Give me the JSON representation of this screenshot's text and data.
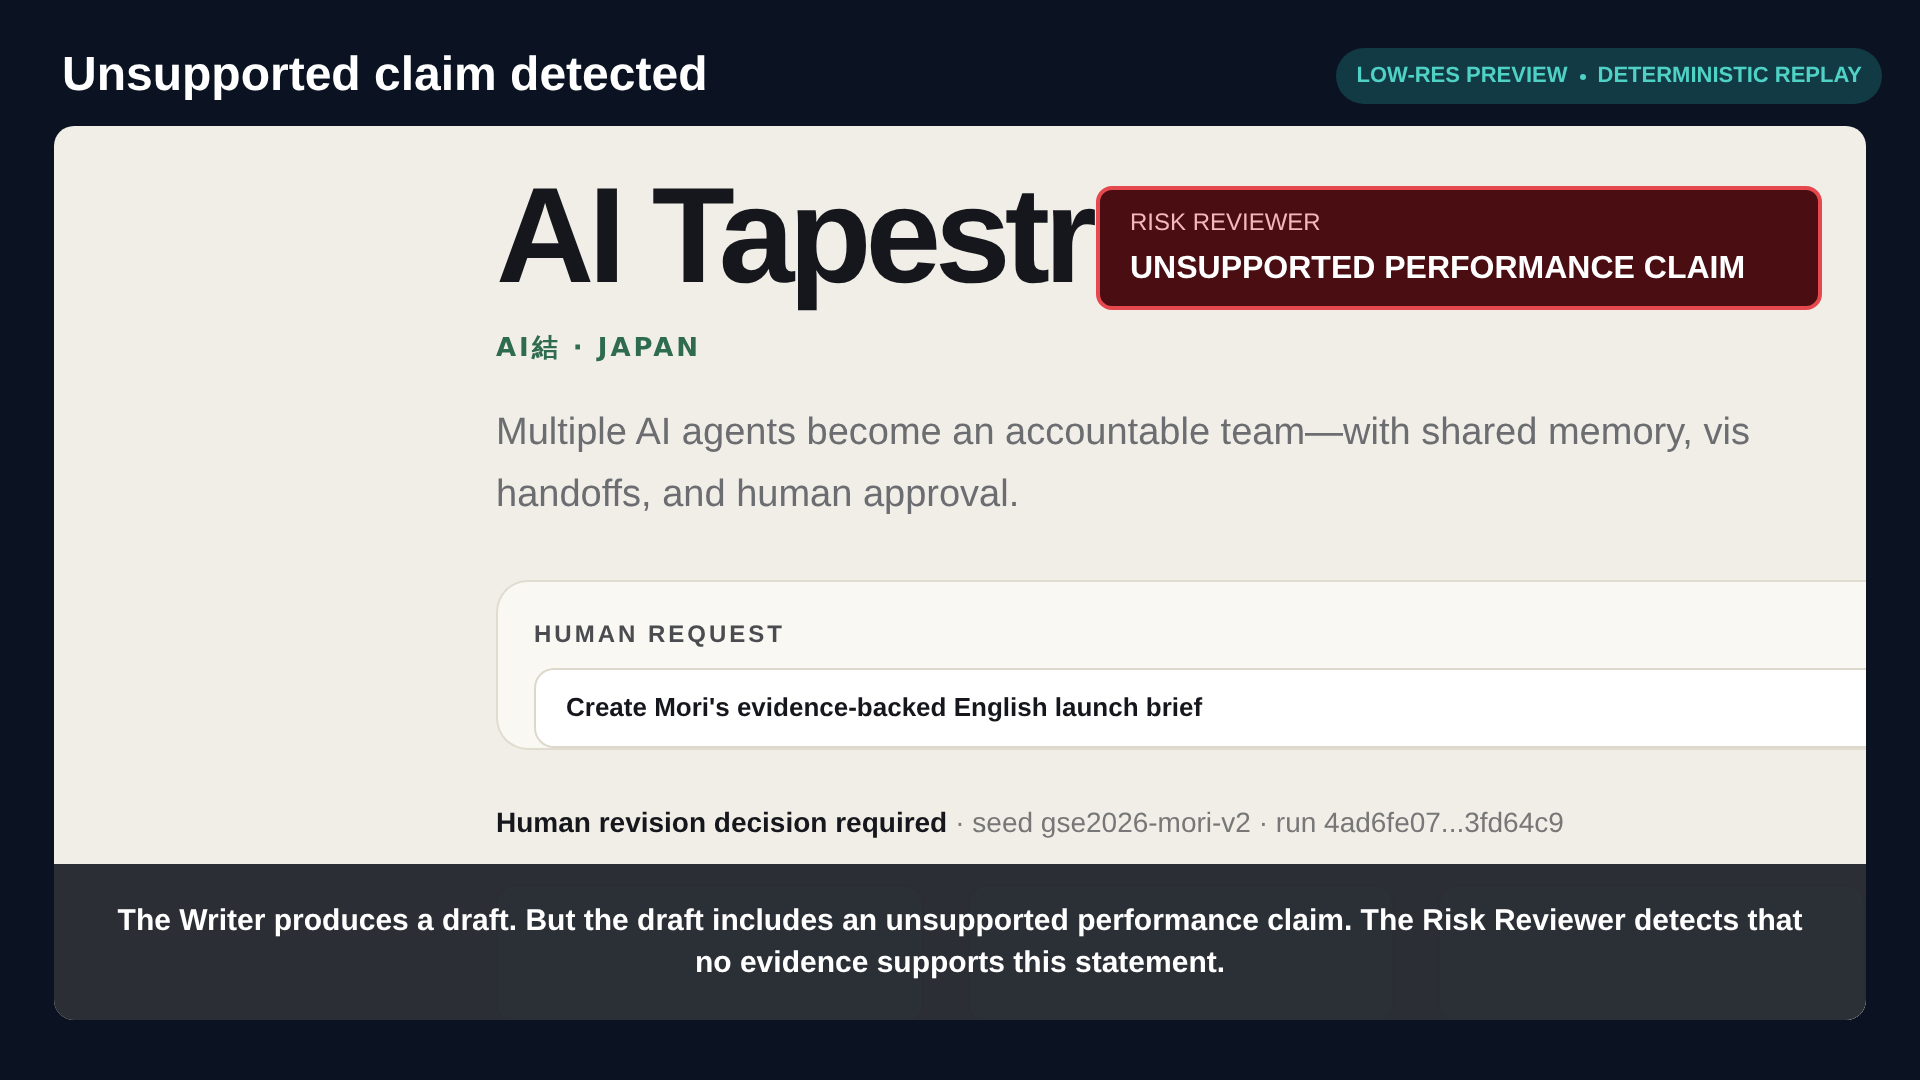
{
  "header": {
    "title": "Unsupported claim detected",
    "badge": [
      "LOW-RES PREVIEW",
      "DETERMINISTIC REPLAY"
    ]
  },
  "page": {
    "title": "AI Tapestr",
    "subtitle": "AI結 · JAPAN",
    "description_lines": [
      "Multiple AI agents become an accountable team—with shared memory, vis",
      "handoffs, and human approval."
    ],
    "request": {
      "label": "HUMAN REQUEST",
      "value": "Create Mori's evidence-backed English launch brief"
    },
    "status": {
      "headline": "Human revision decision required",
      "details": "· seed gse2026-mori-v2 · run 4ad6fe07...3fd64c9"
    }
  },
  "alert": {
    "label": "RISK REVIEWER",
    "message": "UNSUPPORTED PERFORMANCE CLAIM"
  },
  "caption": "The Writer produces a draft. But the draft includes an unsupported performance claim. The Risk Reviewer detects that no evidence supports this statement."
}
